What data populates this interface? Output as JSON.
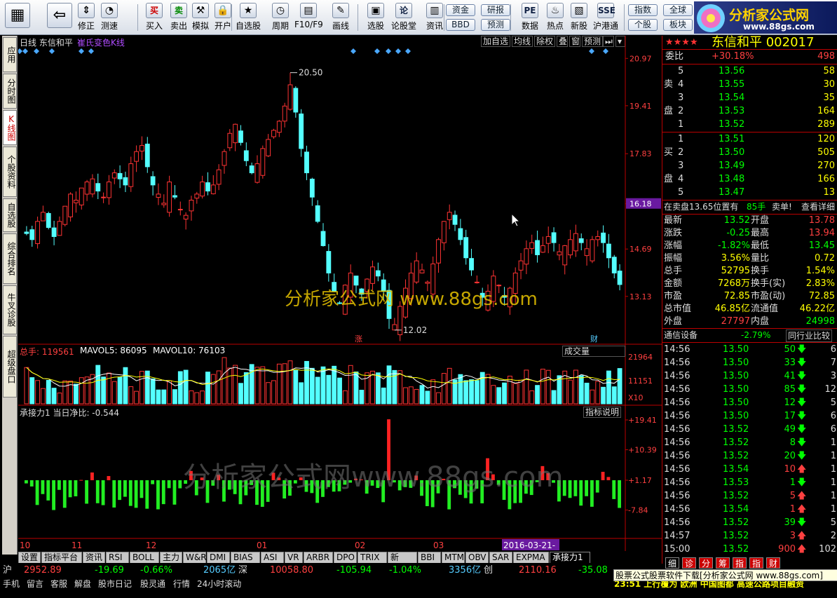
{
  "toolbar": {
    "items": [
      {
        "label": "",
        "icon": "grid-icon"
      },
      {
        "label": "",
        "icon": "back-arrow-icon"
      },
      {
        "label": "修正",
        "icon": "updown-icon"
      },
      {
        "label": "测速",
        "icon": "speed-icon"
      },
      {
        "label": "买入",
        "icon": "buy-icon",
        "icon_text": "买"
      },
      {
        "label": "卖出",
        "icon": "sell-icon",
        "icon_text": "卖"
      },
      {
        "label": "模拟",
        "icon": "hammer-icon"
      },
      {
        "label": "开户",
        "icon": "lock-icon"
      },
      {
        "label": "自选股",
        "icon": "star-icon"
      },
      {
        "label": "周期",
        "icon": "clock-icon"
      },
      {
        "label": "F10/F9",
        "icon": "f10-icon"
      },
      {
        "label": "画线",
        "icon": "pen-icon"
      },
      {
        "label": "选股",
        "icon": "select-icon"
      },
      {
        "label": "论股堂",
        "icon": "forum-icon",
        "icon_text": "论"
      },
      {
        "label": "资讯",
        "icon": "news-icon"
      },
      {
        "label": "数据",
        "icon": "data-icon",
        "icon_text": "PE"
      },
      {
        "label": "热点",
        "icon": "hot-icon"
      },
      {
        "label": "新股",
        "icon": "newstock-icon"
      },
      {
        "label": "沪港通",
        "icon": "hk-icon",
        "icon_text": "SSE"
      }
    ],
    "pills": [
      "资金",
      "研报",
      "BBD",
      "预测",
      "指数",
      "全球",
      "个股",
      "板块"
    ]
  },
  "logo": {
    "title": "分析家公式网",
    "url": "www.88gs.com"
  },
  "sidebar": {
    "tabs": [
      "应用",
      "分时图",
      "K线图",
      "个股资料",
      "自选股",
      "综合排名",
      "牛叉诊股",
      "超级盘口"
    ],
    "active": 2
  },
  "chart": {
    "title": "日线 东信和平",
    "indicator_name": "崔氏变色K线",
    "buttons": [
      "加自选",
      "均线",
      "除权",
      "叠",
      "窗",
      "预测"
    ],
    "price_axis": [
      "20.97",
      "19.41",
      "17.83",
      "16.18",
      "14.69",
      "13.13"
    ],
    "current_price_tag": "16.18",
    "high_label": "20.50",
    "low_label": "12.02",
    "watermark": "分析家公式网 www.88gs.com",
    "watermark2": "分析家公式网www.88gs.com",
    "mark_zhang": "涨",
    "mark_cai": "财",
    "vol": {
      "title": "总手: 119561",
      "mavol5_label": "MAVOL5: 86095",
      "mavol10_label": "MAVOL10: 76103",
      "dropdown": "成交量",
      "axis": [
        "21964",
        "11151",
        "X10"
      ]
    },
    "ind": {
      "title": "承接力1 当日净比: -0.544",
      "button": "指标说明",
      "axis": [
        "+19.41",
        "+10.39",
        "+1.17",
        "-7.84"
      ]
    },
    "date_axis": [
      "10",
      "11",
      "12",
      "01",
      "02",
      "03"
    ],
    "date_highlight": "2016-03-21-"
  },
  "chart_data": {
    "type": "candlestick",
    "price_range": [
      11.6,
      21.3
    ],
    "high": 20.5,
    "low": 12.02,
    "last": 13.52,
    "closes": [
      15.2,
      15.0,
      15.6,
      15.9,
      15.4,
      15.1,
      15.6,
      16.1,
      16.5,
      16.3,
      16.7,
      16.9,
      17.0,
      16.6,
      16.4,
      16.9,
      17.2,
      17.0,
      16.8,
      17.5,
      17.9,
      18.1,
      17.4,
      16.8,
      16.5,
      16.2,
      16.9,
      16.4,
      16.0,
      15.8,
      16.3,
      16.5,
      16.9,
      16.6,
      16.8,
      17.3,
      17.9,
      18.5,
      18.8,
      18.2,
      17.6,
      17.2,
      17.5,
      18.0,
      18.3,
      18.6,
      18.9,
      19.4,
      20.1,
      19.2,
      18.0,
      17.2,
      16.4,
      15.6,
      14.8,
      13.9,
      13.3,
      12.9,
      13.5,
      13.9,
      13.5,
      13.2,
      13.7,
      14.1,
      13.8,
      13.3,
      12.4,
      12.2,
      12.8,
      13.4,
      13.9,
      14.3,
      14.0,
      13.6,
      14.2,
      15.0,
      15.6,
      15.9,
      15.5,
      15.0,
      14.4,
      14.0,
      13.6,
      13.1,
      13.3,
      13.8,
      13.5,
      13.1,
      13.4,
      13.9,
      14.3,
      14.7,
      14.9,
      14.5,
      14.8,
      15.1,
      14.9,
      14.6,
      14.8,
      15.0,
      15.2,
      14.9,
      14.7,
      15.0,
      15.1,
      14.9,
      14.4,
      13.9,
      13.52
    ]
  },
  "right_panel": {
    "name": "东信和平 002017",
    "weibi_label": "委比",
    "weibi": "+30.18%",
    "weicha": "498",
    "sell_label": [
      "卖",
      "盘"
    ],
    "buy_label": [
      "买",
      "盘"
    ],
    "sell": [
      [
        "5",
        "13.56",
        "58"
      ],
      [
        "4",
        "13.55",
        "30"
      ],
      [
        "3",
        "13.54",
        "35"
      ],
      [
        "2",
        "13.53",
        "164"
      ],
      [
        "1",
        "13.52",
        "289"
      ]
    ],
    "buy": [
      [
        "1",
        "13.51",
        "120"
      ],
      [
        "2",
        "13.50",
        "505"
      ],
      [
        "3",
        "13.49",
        "270"
      ],
      [
        "4",
        "13.48",
        "166"
      ],
      [
        "5",
        "13.47",
        "13"
      ]
    ],
    "notice_left": "在卖盘13.65位置有",
    "notice_mid": "85手",
    "notice_right": "卖单!",
    "notice_link": "查看详细",
    "stats": [
      [
        "最新",
        "13.52",
        "开盘",
        "13.78"
      ],
      [
        "涨跌",
        "-0.25",
        "最高",
        "13.94"
      ],
      [
        "涨幅",
        "-1.82%",
        "最低",
        "13.45"
      ],
      [
        "振幅",
        "3.56%",
        "量比",
        "0.72"
      ],
      [
        "总手",
        "52795",
        "换手",
        "1.54%"
      ],
      [
        "金额",
        "7268万",
        "换手(实)",
        "2.83%"
      ],
      [
        "市盈",
        "72.85",
        "市盈(动)",
        "72.85"
      ],
      [
        "总市值",
        "46.85亿",
        "流通值",
        "46.22亿"
      ],
      [
        "外盘",
        "27797",
        "内盘",
        "24998"
      ]
    ],
    "industry": "通信设备",
    "industry_chg": "-2.79%",
    "peer_btn": "同行业比较",
    "ticks": [
      [
        "14:56",
        "13.50",
        "50",
        "6"
      ],
      [
        "14:56",
        "13.50",
        "33",
        "7"
      ],
      [
        "14:56",
        "13.50",
        "41",
        "3"
      ],
      [
        "14:56",
        "13.50",
        "85",
        "12"
      ],
      [
        "14:56",
        "13.50",
        "12",
        "5"
      ],
      [
        "14:56",
        "13.50",
        "17",
        "6"
      ],
      [
        "14:56",
        "13.52",
        "49",
        "6"
      ],
      [
        "14:56",
        "13.52",
        "8",
        "1"
      ],
      [
        "14:56",
        "13.52",
        "20",
        "1"
      ],
      [
        "14:56",
        "13.54",
        "10",
        "1"
      ],
      [
        "14:56",
        "13.53",
        "1",
        "1"
      ],
      [
        "14:56",
        "13.52",
        "5",
        "1"
      ],
      [
        "14:56",
        "13.54",
        "1",
        "1"
      ],
      [
        "14:56",
        "13.52",
        "39",
        "5"
      ],
      [
        "14:57",
        "13.52",
        "3",
        "2"
      ],
      [
        "15:00",
        "13.52",
        "900",
        "102"
      ]
    ],
    "tick_dirs": [
      "d",
      "d",
      "d",
      "d",
      "d",
      "d",
      "d",
      "d",
      "d",
      "u",
      "d",
      "u",
      "u",
      "d",
      "u",
      "u"
    ],
    "bottom_tabs": [
      "细",
      "诊",
      "分",
      "筹",
      "指",
      "指",
      "财"
    ],
    "promo": "股票公式股票软件下载[分析家公式网 www.88gs.com]",
    "news": "23:51 上行覆为 欧洲 中国图都 高速公路项目融资"
  },
  "bottom_tabs": [
    "设置",
    "指标平台",
    "资讯",
    "RSI",
    "BOLL",
    "主力",
    "W&R",
    "DMI",
    "BIAS",
    "ASI",
    "VR",
    "ARBR",
    "DPO",
    "TRIX",
    "新DMA",
    "BBI",
    "MTM",
    "OBV",
    "SAR",
    "EXPMA",
    "承接力1"
  ],
  "status": {
    "sh_label": "沪",
    "sh_idx": "2952.89",
    "sh_chg": "-19.69",
    "sh_pct": "-0.66%",
    "sh_amt": "2065亿",
    "sz_label": "深",
    "sz_idx": "10058.80",
    "sz_chg": "-105.94",
    "sz_pct": "-1.04%",
    "sz_amt": "3356亿",
    "cy_label": "创",
    "cy_idx": "2110.16",
    "cy_chg": "-35.08"
  },
  "status2": [
    "手机",
    "留言",
    "客服",
    "解盘",
    "股市日记",
    "股灵通",
    "行情",
    "24小时滚动"
  ]
}
